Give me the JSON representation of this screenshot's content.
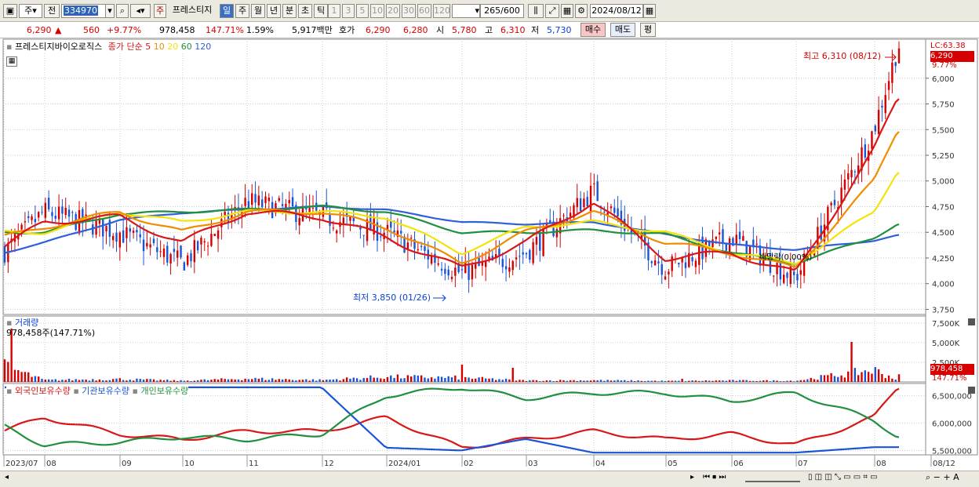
{
  "toolbar": {
    "period": "주",
    "prev": "전",
    "code": "334970",
    "name_badge": "주",
    "stock_name": "프레스티지",
    "periods": [
      "일",
      "주",
      "월",
      "년",
      "분",
      "초",
      "틱"
    ],
    "active_period": "일",
    "counts": [
      "1",
      "3",
      "5",
      "10",
      "20",
      "30",
      "60",
      "120"
    ],
    "visible_count": "265",
    "total_count": "600",
    "date": "2024/08/12"
  },
  "quote": {
    "price": "6,290",
    "arrow": "▲",
    "change": "560",
    "change_pct": "+9.77%",
    "volume": "978,458",
    "vol_ratio": "147.71%",
    "turnover": "1.59%",
    "amount": "5,917백만",
    "hoga_label": "호가",
    "bid": "6,290",
    "ask": "6,280",
    "open_label": "시",
    "open": "5,780",
    "high_label": "고",
    "high": "6,310",
    "low_label": "저",
    "low": "5,730",
    "buy": "매수",
    "sell": "매도",
    "avg": "평"
  },
  "price_panel": {
    "stock_name": "프레스티지바이오로직스",
    "ma_label": "종가 단순",
    "ma_periods": [
      5,
      10,
      20,
      60,
      120
    ],
    "ma_colors": [
      "#d81818",
      "#f08c00",
      "#f2e40a",
      "#209040",
      "#3060d8"
    ],
    "lc_label": "LC:63.38",
    "cur_price": "6,290",
    "cur_pct": "9.77%",
    "hi_label": "최고 6,310 (08/12)",
    "lo_label": "최저 3,850 (01/26)",
    "marker_label": "배당락(0.00%)",
    "y_ticks": [
      3750,
      4000,
      4250,
      4500,
      4750,
      5000,
      5250,
      5500,
      5750,
      6000
    ],
    "up_color": "#d40000",
    "down_color": "#1a54d6"
  },
  "volume_panel": {
    "title": "거래량",
    "value_label": "978,458주(147.71%)",
    "y_ticks": [
      "2,500K",
      "5,000K",
      "7,500K"
    ],
    "cur_value": "978,458",
    "cur_pct": "147.71%"
  },
  "holding_panel": {
    "labels": [
      "외국인보유수량",
      "기관보유수량",
      "개인보유수량"
    ],
    "colors": [
      "#d81818",
      "#1a54d6",
      "#209040"
    ],
    "y_ticks": [
      "5,500,000",
      "6,000,000",
      "6,500,000"
    ]
  },
  "x_labels": [
    "2023/07",
    "08",
    "09",
    "10",
    "11",
    "12",
    "2024/01",
    "02",
    "03",
    "04",
    "05",
    "06",
    "07",
    "08",
    "08/12"
  ],
  "chart_data": [
    {
      "type": "candlestick",
      "title": "프레스티지바이오로직스",
      "xlabel": "",
      "ylabel": "",
      "ylim": [
        3700,
        6380
      ],
      "x": [
        "2023/07",
        "08",
        "09",
        "10",
        "11",
        "12",
        "2024/01",
        "02",
        "03",
        "04",
        "05",
        "06",
        "07",
        "08",
        "08/12"
      ],
      "close": [
        4300,
        4700,
        4500,
        4200,
        4800,
        4650,
        4500,
        4100,
        4300,
        4900,
        4150,
        4450,
        4050,
        5500,
        6290
      ],
      "series": [
        {
          "name": "5",
          "values": [
            4350,
            4600,
            4650,
            4400,
            4700,
            4650,
            4450,
            4150,
            4400,
            4800,
            4250,
            4300,
            4100,
            5300,
            5800
          ]
        },
        {
          "name": "10",
          "values": [
            4450,
            4550,
            4700,
            4500,
            4700,
            4700,
            4550,
            4200,
            4500,
            4700,
            4400,
            4300,
            4150,
            5000,
            5500
          ]
        },
        {
          "name": "20",
          "values": [
            4500,
            4500,
            4700,
            4600,
            4700,
            4700,
            4650,
            4300,
            4550,
            4600,
            4500,
            4300,
            4200,
            4700,
            5100
          ]
        },
        {
          "name": "60",
          "values": [
            4500,
            4500,
            4680,
            4700,
            4720,
            4750,
            4700,
            4500,
            4500,
            4520,
            4480,
            4300,
            4200,
            4450,
            4580
          ]
        },
        {
          "name": "120",
          "values": [
            4300,
            4400,
            4620,
            4690,
            4720,
            4750,
            4720,
            4600,
            4580,
            4600,
            4480,
            4380,
            4330,
            4420,
            4470
          ]
        }
      ]
    },
    {
      "type": "bar",
      "title": "거래량",
      "series": [
        {
          "name": "거래량",
          "values": [
            6800,
            800,
            1200,
            500,
            1400,
            800,
            2200,
            1800,
            600,
            700,
            400,
            600,
            500,
            5100,
            978
          ]
        }
      ]
    },
    {
      "type": "line",
      "title": "보유수량",
      "ylim": [
        5420000,
        6720000
      ],
      "x": [
        "2023/07",
        "08",
        "09",
        "10",
        "11",
        "12",
        "2024/01",
        "02",
        "03",
        "04",
        "05",
        "06",
        "07",
        "08",
        "08/12"
      ],
      "series": [
        {
          "name": "외국인보유수량",
          "values": [
            5850000,
            6100000,
            5800000,
            5700000,
            5850000,
            5850000,
            6100000,
            5550000,
            5700000,
            5850000,
            5700000,
            5800000,
            5600000,
            6100000,
            6650000
          ]
        },
        {
          "name": "기관보유수량",
          "values": [
            6650000,
            6650000,
            6650000,
            6650000,
            6650000,
            6650000,
            5550000,
            5500000,
            5710000,
            5460000,
            5460000,
            5460000,
            5460000,
            5560000,
            5560000
          ]
        },
        {
          "name": "개인보유수량",
          "values": [
            5950000,
            5600000,
            5650000,
            5750000,
            5700000,
            5800000,
            6500000,
            6650000,
            6450000,
            6550000,
            6550000,
            6400000,
            6550000,
            6050000,
            5760000
          ]
        }
      ]
    }
  ]
}
